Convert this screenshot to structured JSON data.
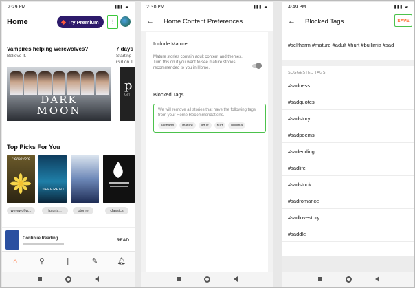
{
  "screen1": {
    "status_time": "2:29 PM",
    "title": "Home",
    "premium_label": "Try Premium",
    "story1_title": "Vampires helping werewolves?",
    "story1_sub": "Believe it.",
    "story2_title": "7 days",
    "story2_sub1": "Starting",
    "story2_sub2": "Girl on T",
    "cover1_line1": "DARK",
    "cover1_line2": "MOON",
    "cover2_glyph": "p",
    "cover2_text": "Girl",
    "section_title": "Top Picks For You",
    "picks": [
      {
        "cover_text": "Persevere",
        "chip": "werewolfw..."
      },
      {
        "cover_text": "DIFFERENT",
        "chip": "futuris..."
      },
      {
        "cover_text": "",
        "chip": "otome"
      },
      {
        "cover_text": "",
        "chip": "classics"
      }
    ],
    "continue_label": "Continue Reading",
    "read_label": "READ",
    "tabs": [
      "home-icon",
      "search-icon",
      "library-icon",
      "write-icon",
      "bell-icon"
    ]
  },
  "screen2": {
    "status_time": "2:30 PM",
    "title": "Home Content Preferences",
    "mature_heading": "Include Mature",
    "mature_desc": "Mature stories contain adult content and themes. Turn this on if you want to see mature stories recommended to you in Home.",
    "mature_on": false,
    "blocked_heading": "Blocked Tags",
    "blocked_desc": "We will remove all stories that have the following tags from your Home Recommendations.",
    "blocked_tags": [
      "selfharm",
      "mature",
      "adult",
      "hurt",
      "bullimia"
    ]
  },
  "screen3": {
    "status_time": "4:49 PM",
    "title": "Blocked Tags",
    "save_label": "SAVE",
    "input_value": "#selfharm #mature #adult #hurt #bullimia #sad",
    "suggested_heading": "SUGGESTED TAGS",
    "suggestions": [
      "#sadness",
      "#sadquotes",
      "#sadstory",
      "#sadpoems",
      "#sadending",
      "#sadlife",
      "#sadstuck",
      "#sadromance",
      "#sadlovestory",
      "#saddle"
    ]
  },
  "colors": {
    "accent": "#ff6122",
    "highlight": "#4cc24c",
    "premium_bg": "#2d1a6b"
  }
}
